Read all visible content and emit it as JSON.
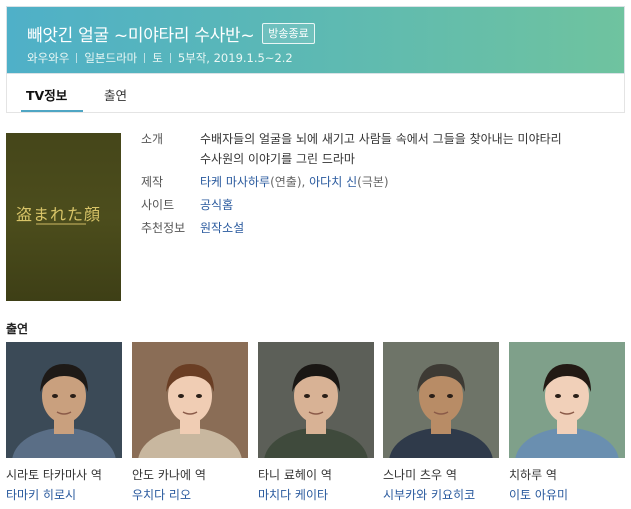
{
  "header": {
    "title": "빼앗긴 얼굴 ~미야타리 수사반~",
    "badge": "방송종료",
    "meta": [
      "와우와우",
      "일본드라마",
      "토",
      "5부작, 2019.1.5~2.2"
    ]
  },
  "tabs": [
    {
      "label": "TV정보",
      "active": true
    },
    {
      "label": "출연",
      "active": false
    }
  ],
  "poster": {
    "title": "盗まれた顔"
  },
  "info": {
    "intro_label": "소개",
    "intro_line1": "수배자들의 얼굴을 뇌에 새기고 사람들 속에서 그들을 찾아내는 미야타리",
    "intro_line2": "수사원의 이야기를 그린 드라마",
    "production_label": "제작",
    "director": "타케 마사하루",
    "director_role": "(연출), ",
    "writer": "아다치 신",
    "writer_role": "(극본)",
    "site_label": "사이트",
    "site_link": "공식홈",
    "recommend_label": "추천정보",
    "recommend_link": "원작소설"
  },
  "cast": {
    "heading": "출연",
    "members": [
      {
        "role": "시라토 타카마사 역",
        "actor": "타마키 히로시",
        "bg": "#3b4a57",
        "skin": "#c9a07e",
        "hair": "#1e1a17",
        "cloth": "#5a6e86"
      },
      {
        "role": "안도 카나에 역",
        "actor": "우치다 리오",
        "bg": "#8a6d56",
        "skin": "#f0cdb4",
        "hair": "#6a3e24",
        "cloth": "#c8b79f"
      },
      {
        "role": "타니 료헤이 역",
        "actor": "마치다 케이타",
        "bg": "#5c5f58",
        "skin": "#d8b295",
        "hair": "#1a1714",
        "cloth": "#3f4a3c"
      },
      {
        "role": "스나미 츠우 역",
        "actor": "시부카와 키요히코",
        "bg": "#6e7468",
        "skin": "#b88c66",
        "hair": "#3d3a34",
        "cloth": "#2f3a4a"
      },
      {
        "role": "치하루 역",
        "actor": "이토 아유미",
        "bg": "#7fa08a",
        "skin": "#f1d0b9",
        "hair": "#231a14",
        "cloth": "#6a8fb0"
      }
    ]
  }
}
